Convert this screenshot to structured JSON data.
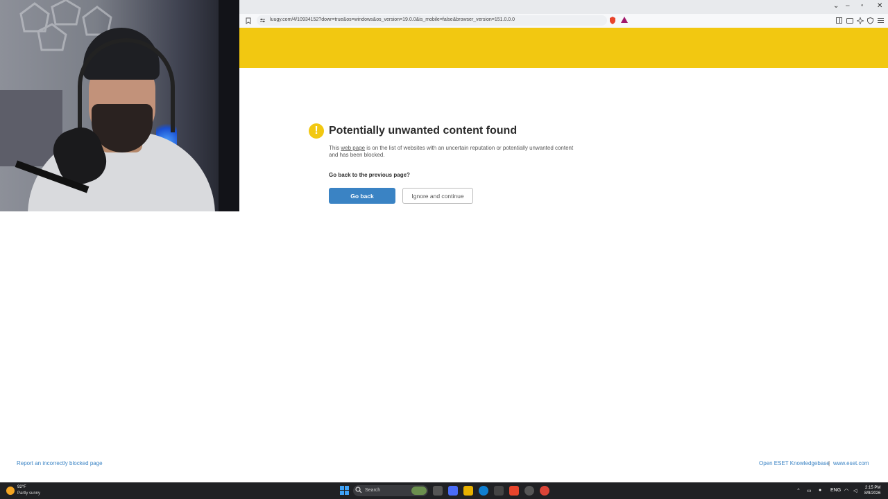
{
  "browser": {
    "url": "luugy.com/4/10934152?dowr=true&os=windows&os_version=19.0.0&is_mobile=false&browser_version=151.0.0.0",
    "window_controls": {
      "dropdown": "⌄",
      "minimize": "–",
      "restore": "▫",
      "close": "✕"
    }
  },
  "page": {
    "title": "Potentially unwanted content found",
    "description_pre": "This ",
    "description_link": "web page",
    "description_post": " is on the list of websites with an uncertain reputation or potentially unwanted content and has been blocked.",
    "question": "Go back to the previous page?",
    "go_back_label": "Go back",
    "ignore_label": "Ignore and continue",
    "warning_glyph": "!"
  },
  "footer": {
    "report_link": "Report an incorrectly blocked page",
    "kb_link": "Open ESET Knowledgebase",
    "separator": "|",
    "site_link": "www.eset.com"
  },
  "taskbar": {
    "weather_temp": "92°F",
    "weather_condition": "Partly sunny",
    "search_placeholder": "Search",
    "language": "ENG",
    "time": "2:15 PM",
    "date": "8/9/2026"
  },
  "colors": {
    "banner": "#f2c811",
    "primary_button": "#3a83c4",
    "link": "#3a83c4",
    "taskbar": "#202124"
  }
}
